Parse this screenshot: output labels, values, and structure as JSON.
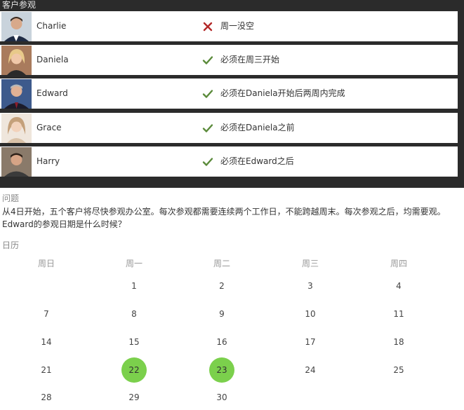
{
  "panel": {
    "title": "客户参观",
    "clients": [
      {
        "name": "Charlie",
        "status": "cross",
        "note": "周一没空"
      },
      {
        "name": "Daniela",
        "status": "check",
        "note": "必须在周三开始"
      },
      {
        "name": "Edward",
        "status": "check",
        "note": "必须在Daniela开始后两周内完成"
      },
      {
        "name": "Grace",
        "status": "check",
        "note": "必须在Daniela之前"
      },
      {
        "name": "Harry",
        "status": "check",
        "note": "必须在Edward之后"
      }
    ]
  },
  "question": {
    "label": "问题",
    "text": "从4日开始，五个客户将尽快参观办公室。每次参观都需要连续两个工作日，不能跨越周末。每次参观之后，均需要观。Edward的参观日期是什么时候？"
  },
  "calendar": {
    "label": "日历",
    "weekdays": [
      "周日",
      "周一",
      "周二",
      "周三",
      "周四"
    ],
    "weeks": [
      [
        "",
        "1",
        "2",
        "3",
        "4"
      ],
      [
        "7",
        "8",
        "9",
        "10",
        "11"
      ],
      [
        "14",
        "15",
        "16",
        "17",
        "18"
      ],
      [
        "21",
        "22",
        "23",
        "24",
        "25"
      ],
      [
        "28",
        "29",
        "30",
        "",
        ""
      ]
    ],
    "selected": [
      "22",
      "23"
    ]
  },
  "colors": {
    "check": "#5a8a3a",
    "cross": "#b32828",
    "selected": "#7bd04c",
    "panel": "#2b2b2b"
  }
}
